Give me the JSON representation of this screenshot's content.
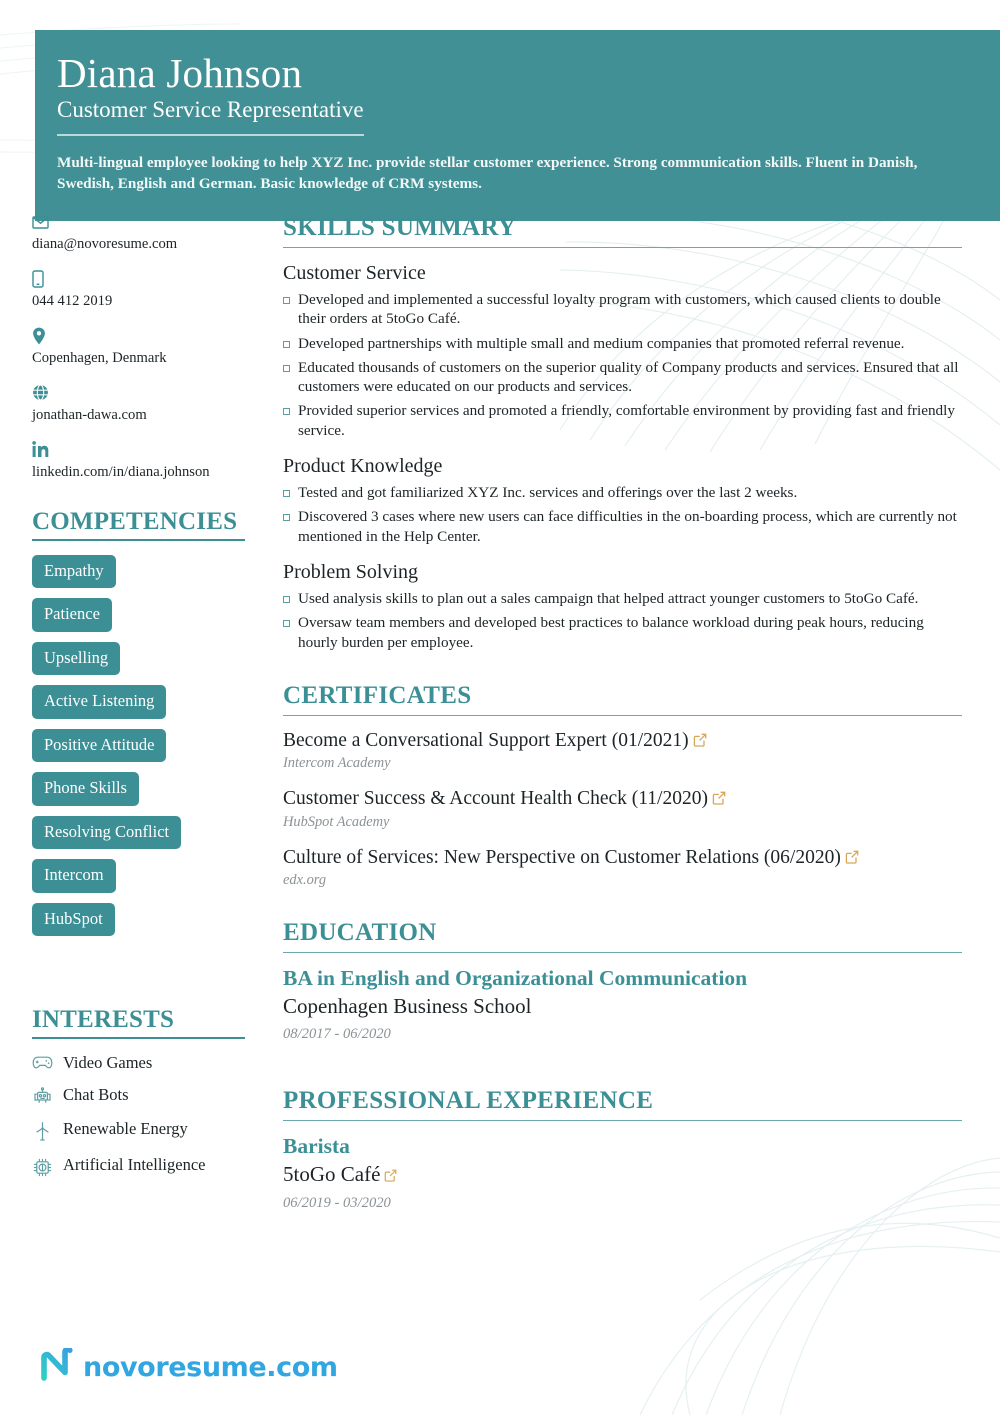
{
  "theme": {
    "teal": "#419095",
    "teal_dark": "#3b8f95",
    "accent_link": "#d7a757",
    "logo_blue": "#31a6e0",
    "muted": "#8b9296"
  },
  "header": {
    "name": "Diana Johnson",
    "job_title": "Customer Service Representative",
    "summary": "Multi-lingual employee looking to help XYZ Inc. provide stellar customer experience. Strong communication skills. Fluent in Danish, Swedish, English and German. Basic knowledge of CRM systems."
  },
  "contact": {
    "items": [
      {
        "icon": "envelope-icon",
        "value": "diana@novoresume.com"
      },
      {
        "icon": "mobile-phone-icon",
        "value": "044 412 2019"
      },
      {
        "icon": "location-pin-icon",
        "value": "Copenhagen, Denmark"
      },
      {
        "icon": "globe-icon",
        "value": "jonathan-dawa.com"
      },
      {
        "icon": "linkedin-icon",
        "value": "linkedin.com/in/diana.johnson"
      }
    ]
  },
  "competencies": {
    "heading": "COMPETENCIES",
    "items": [
      "Empathy",
      "Patience",
      "Upselling",
      "Active Listening",
      "Positive Attitude",
      "Phone Skills",
      "Resolving Conflict",
      "Intercom",
      "HubSpot"
    ]
  },
  "interests": {
    "heading": "INTERESTS",
    "items": [
      {
        "icon": "gamepad-icon",
        "label": "Video Games"
      },
      {
        "icon": "robot-icon",
        "label": "Chat Bots"
      },
      {
        "icon": "wind-turbine-icon",
        "label": "Renewable Energy"
      },
      {
        "icon": "microchip-icon",
        "label": "Artificial Intelligence"
      }
    ]
  },
  "skills_summary": {
    "heading": "SKILLS SUMMARY",
    "groups": [
      {
        "title": "Customer Service",
        "bullets": [
          "Developed and implemented a successful loyalty program with customers, which caused clients to double their orders at 5toGo Café.",
          "Developed partnerships with multiple small and medium companies that promoted referral revenue.",
          "Educated thousands of customers on the superior quality of Company products and services. Ensured that all customers were educated on our products and services.",
          "Provided superior services and promoted a friendly, comfortable environment by providing fast and friendly service."
        ]
      },
      {
        "title": "Product Knowledge",
        "bullets": [
          "Tested and got familiarized XYZ Inc. services and offerings over the last 2 weeks.",
          "Discovered 3 cases where new users can face difficulties in the on-boarding process, which are currently not mentioned in the Help Center."
        ]
      },
      {
        "title": "Problem Solving",
        "bullets": [
          "Used analysis skills to plan out a sales campaign that helped attract younger customers to 5toGo Café.",
          "Oversaw team members and developed best practices to balance workload during peak hours, reducing hourly burden per employee."
        ]
      }
    ]
  },
  "certificates": {
    "heading": "CERTIFICATES",
    "items": [
      {
        "title": "Become a Conversational Support Expert (01/2021)",
        "organization": "Intercom Academy",
        "link_icon": "external-link-icon"
      },
      {
        "title": "Customer Success & Account Health Check (11/2020)",
        "organization": "HubSpot Academy",
        "link_icon": "external-link-icon"
      },
      {
        "title": "Culture of Services: New Perspective on Customer Relations (06/2020)",
        "organization": "edx.org",
        "link_icon": "external-link-icon"
      }
    ]
  },
  "education": {
    "heading": "EDUCATION",
    "items": [
      {
        "degree": "BA in English and Organizational Communication",
        "school": "Copenhagen Business School",
        "dates": "08/2017 - 06/2020"
      }
    ]
  },
  "experience": {
    "heading": "PROFESSIONAL EXPERIENCE",
    "items": [
      {
        "role": "Barista",
        "company": "5toGo Café",
        "link_icon": "external-link-icon",
        "dates": "06/2019 - 03/2020"
      }
    ]
  },
  "footer": {
    "logo_mark": "novoresume-logo-icon",
    "logo_text": "novoresume.com"
  }
}
